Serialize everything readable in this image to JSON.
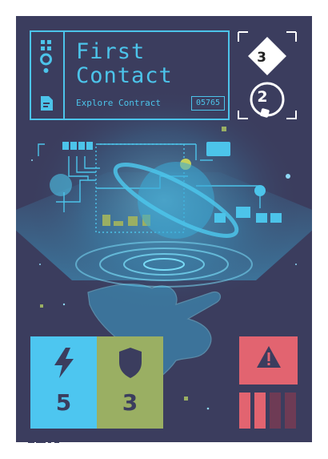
{
  "card": {
    "title_line1": "First",
    "title_line2": "Contact",
    "subtitle": "Explore Contract",
    "code": "05765",
    "cost_primary": "3",
    "cost_secondary": "2"
  },
  "stats": {
    "energy": {
      "icon": "lightning-icon",
      "value": "5",
      "color": "#4dc6f0"
    },
    "shield": {
      "icon": "shield-icon",
      "value": "3",
      "color": "#9aaf63"
    }
  },
  "hazard": {
    "icon": "warning-icon",
    "color": "#e26470",
    "pips_total": 4,
    "pips_filled": 2
  },
  "colors": {
    "card_bg": "#3b3d5e",
    "accent": "#4cc4ea"
  }
}
